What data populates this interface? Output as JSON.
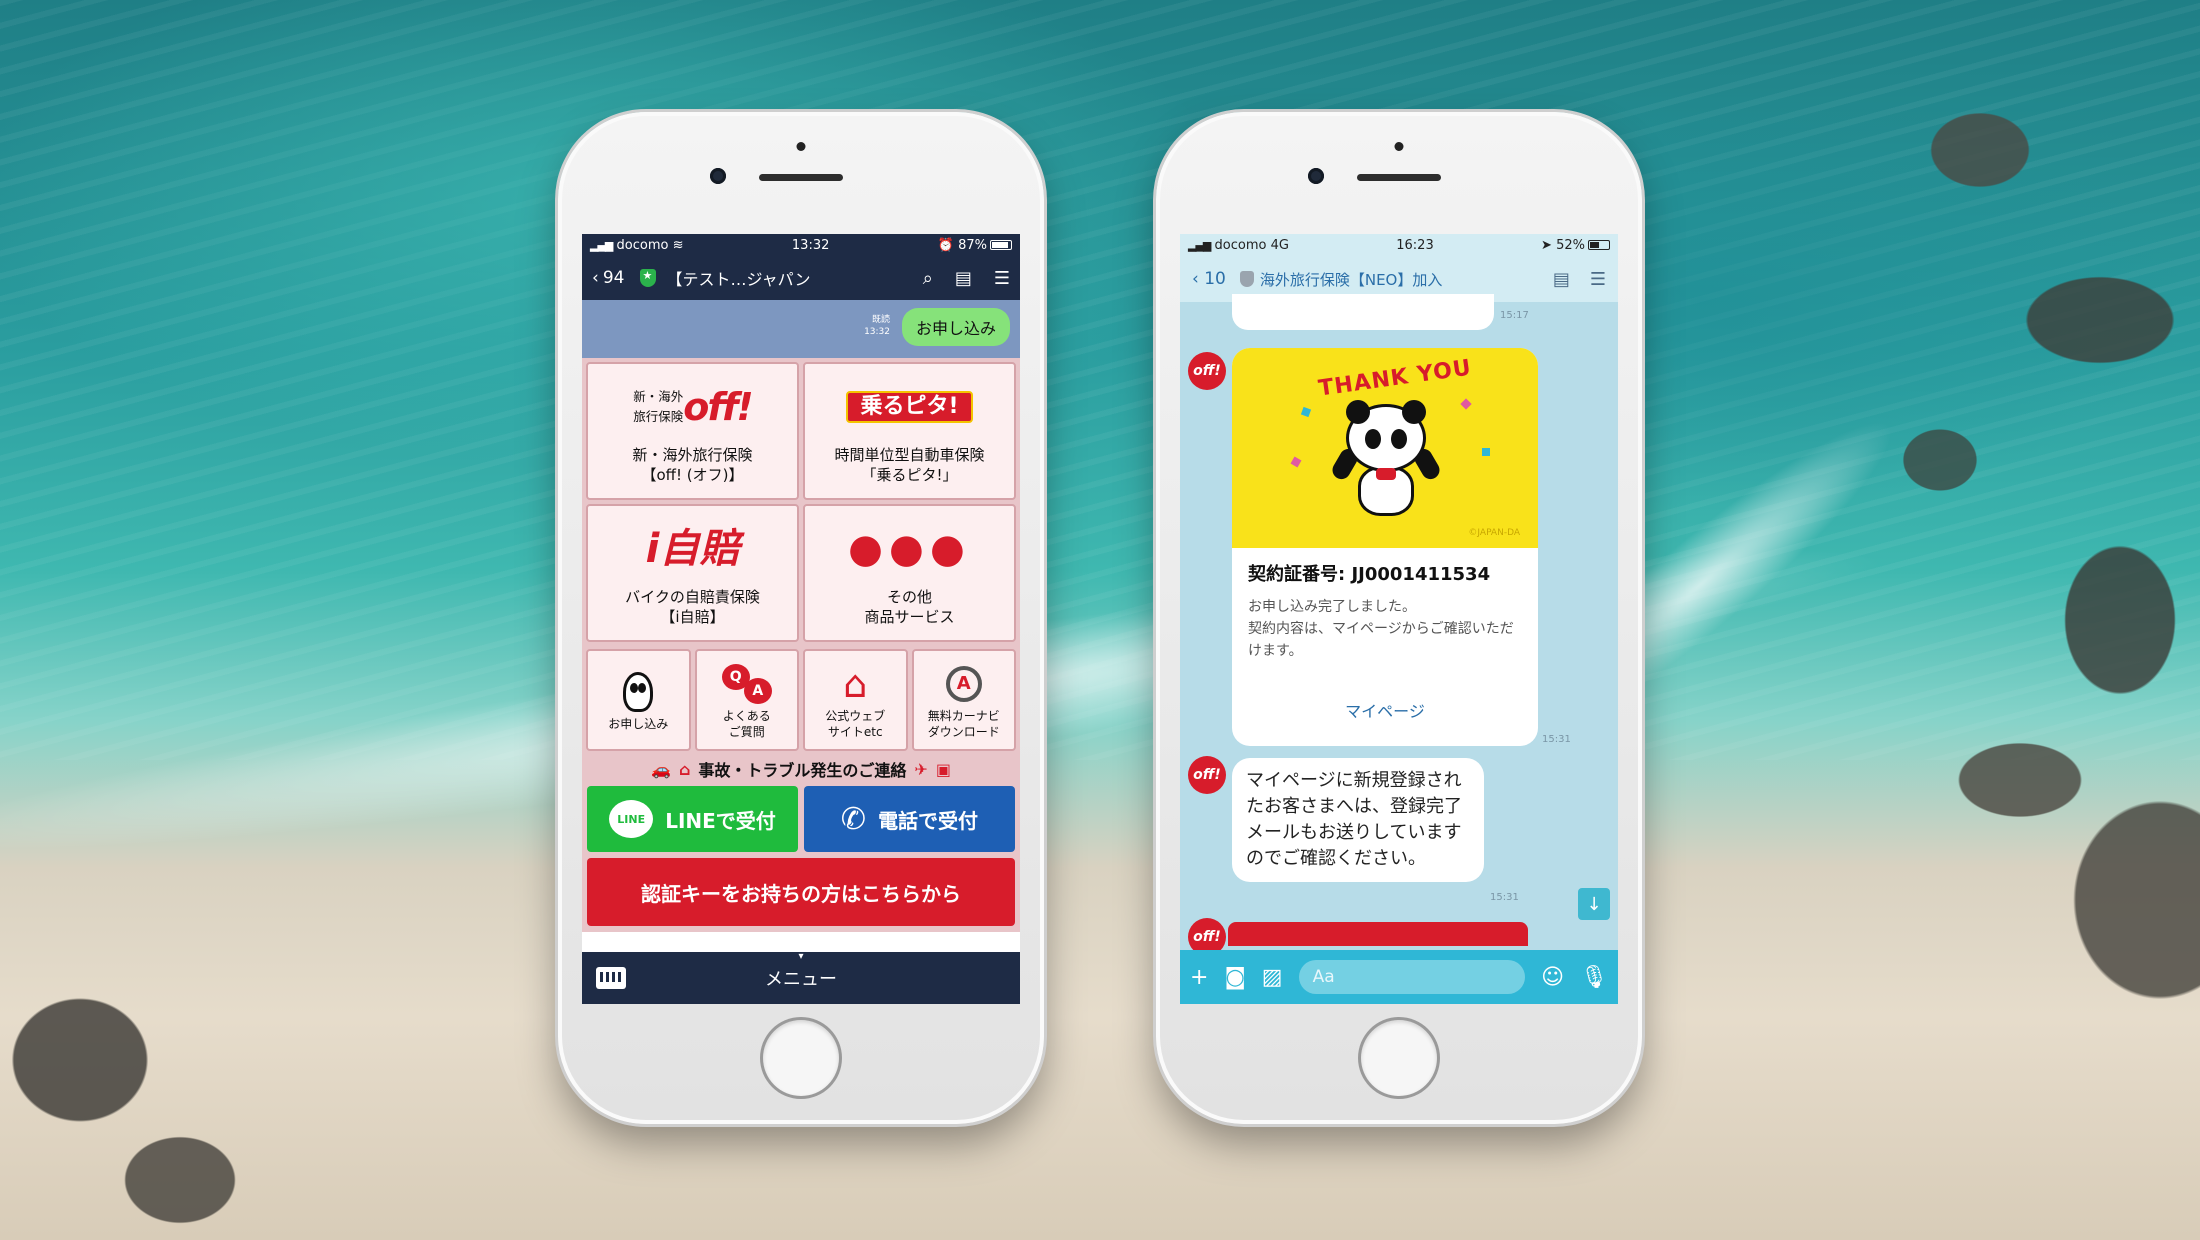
{
  "left_phone": {
    "status": {
      "carrier": "docomo",
      "time": "13:32",
      "battery": "87%",
      "battery_fraction": 0.87
    },
    "nav": {
      "back_count": "94",
      "title": "【テスト…ジャパン"
    },
    "sent_message": {
      "text": "お申し込み",
      "read_label": "既読",
      "time": "13:32"
    },
    "rich_menu": [
      {
        "logo_small": "新・海外\n旅行保険",
        "logo": "off!",
        "label_line1": "新・海外旅行保険",
        "label_line2": "【off! (オフ)】"
      },
      {
        "logo": "乗るピタ!",
        "label_line1": "時間単位型自動車保険",
        "label_line2": "「乗るピタ!」"
      },
      {
        "logo": "i自賠",
        "label_line1": "バイクの自賠責保険",
        "label_line2": "【i自賠】"
      },
      {
        "logo": "●●●",
        "label_line1": "その他",
        "label_line2": "商品サービス"
      }
    ],
    "small_menu": [
      {
        "icon": "panda-icon",
        "label_line1": "お申し込み",
        "label_line2": ""
      },
      {
        "icon": "qa-icon",
        "label_line1": "よくある",
        "label_line2": "ご質問"
      },
      {
        "icon": "home-icon",
        "label_line1": "公式ウェブ",
        "label_line2": "サイトetc"
      },
      {
        "icon": "navi-icon",
        "label_line1": "無料カーナビ",
        "label_line2": "ダウンロード"
      }
    ],
    "accident_label": "事故・トラブル発生のご連絡",
    "line_badge": "LINE",
    "line_button": "LINEで受付",
    "tel_button": "電話で受付",
    "auth_button": "認証キーをお持ちの方はこちらから",
    "menu_label": "メニュー",
    "colors": {
      "navy": "#1e2b45",
      "red": "#d71c2b",
      "green": "#1fbb3d",
      "blue": "#1e5fb4"
    }
  },
  "right_phone": {
    "status": {
      "carrier": "docomo 4G",
      "time": "16:23",
      "battery": "52%",
      "battery_fraction": 0.52
    },
    "nav": {
      "back_count": "10",
      "title": "海外旅行保険【NEO】加入"
    },
    "avatar_label": "off!",
    "times": {
      "prev": "15:17",
      "card": "15:31",
      "bubble": "15:31"
    },
    "card": {
      "sticker_text": "THANK YOU",
      "copyright": "©JAPAN-DA",
      "contract_number": "契約証番号: JJ0001411534",
      "message_line1": "お申し込み完了しました。",
      "message_line2": "契約内容は、マイページからご確認いただけます。",
      "link": "マイページ"
    },
    "bubble_text": "マイページに新規登録されたお客さまへは、登録完了メールもお送りしていますのでご確認ください。",
    "input_placeholder": "Aa",
    "colors": {
      "accent": "#2fb7d6",
      "chat_bg": "#b7dce8",
      "sticker_bg": "#f9e21a"
    }
  }
}
